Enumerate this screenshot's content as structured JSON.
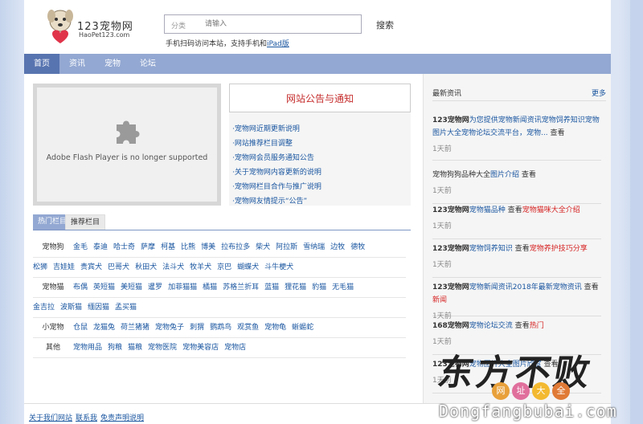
{
  "header": {
    "logo_name": "123宠物网",
    "logo_domain": "HaoPet123.com",
    "search_category": "分类",
    "search_placeholder": "请输入",
    "search_button": "搜索",
    "search_hint_text": "手机扫码访问本站，支持手机和",
    "search_hint_link": "iPad版"
  },
  "nav": {
    "items": [
      "首页",
      "资讯",
      "宠物",
      "论坛"
    ]
  },
  "flash": {
    "message": "Adobe Flash Player is no longer supported"
  },
  "notice": {
    "title": "网站公告与通知",
    "items": [
      "·宠物网近期更新说明",
      "·网站推荐栏目调整",
      "·宠物网会员服务通知公告",
      "·关于宠物网内容更新的说明",
      "·宠物网栏目合作与推广说明",
      "·宠物网友情提示“公告”"
    ]
  },
  "tabs": [
    "热门栏目",
    "推荐栏目"
  ],
  "link_rows": [
    {
      "label": "宠物狗",
      "links": [
        "金毛",
        "泰迪",
        "哈士奇",
        "萨摩",
        "柯基",
        "比熊",
        "博美",
        "拉布拉多",
        "柴犬",
        "阿拉斯",
        "雪纳瑞",
        "边牧",
        "德牧"
      ]
    },
    {
      "label": "",
      "links": [
        "松狮",
        "吉娃娃",
        "贵宾犬",
        "巴哥犬",
        "秋田犬",
        "法斗犬",
        "牧羊犬",
        "京巴",
        "蝴蝶犬",
        "斗牛梗犬"
      ]
    },
    {
      "label": "宠物猫",
      "links": [
        "布偶",
        "英短猫",
        "美短猫",
        "暹罗",
        "加菲猫猫",
        "橘猫",
        "苏格兰折耳",
        "蓝猫",
        "狸花猫",
        "豹猫",
        "无毛猫"
      ]
    },
    {
      "label": "",
      "links": [
        "金吉拉",
        "波斯猫",
        "缅因猫",
        "孟买猫"
      ]
    },
    {
      "label": "小宠物",
      "links": [
        "仓鼠",
        "龙猫兔",
        "荷兰猪猪",
        "宠物兔子",
        "刺猬",
        "鹦鹉鸟",
        "观赏鱼",
        "宠物龟",
        "蜥蜴蛇"
      ]
    },
    {
      "label": "其他",
      "links": [
        "宠物用品",
        "狗粮",
        "猫粮",
        "宠物医院",
        "宠物美容店",
        "宠物店"
      ]
    }
  ],
  "sidebar": {
    "title": "最新资讯",
    "more": "更多",
    "news": [
      {
        "bold": "123宠物网",
        "link": "为您提供宠物新闻资讯宠物饲养知识宠物图片大全宠物论坛交流平台，宠物...",
        "suffix": " 查看",
        "red": "",
        "time": "1天前"
      },
      {
        "bold": "",
        "pre": "宠物狗狗品种大全",
        "link": "图片介绍",
        "suffix": " 查看",
        "red": "",
        "time": "1天前"
      },
      {
        "bold": "123宠物网",
        "link": "宠物猫品种",
        "suffix": " 查看",
        "red": "宠物猫咪大全介绍",
        "time": "1天前"
      },
      {
        "bold": "123宠物网",
        "link": "宠物饲养知识",
        "suffix": " 查看",
        "red": "宠物养护技巧分享",
        "time": "1天前"
      },
      {
        "bold": "123宠物网",
        "link": "宠物新闻资讯2018年最新宠物资讯",
        "suffix": " 查看",
        "red": "新闻",
        "time": "1天前"
      },
      {
        "bold": "168宠物网",
        "link": "宠物论坛交流",
        "suffix": " 查看",
        "red": "热门",
        "time": "1天前"
      },
      {
        "bold": "123宠物网",
        "link": "宠物图片大全图片欣赏",
        "suffix": " 查看",
        "red": "",
        "time": "1天前"
      }
    ]
  },
  "footer": {
    "links": [
      "关于我们网站",
      "联系我",
      "免责声明说明"
    ]
  },
  "watermark": {
    "big": "东方不败",
    "sub": [
      "网",
      "址",
      "大",
      "全"
    ],
    "sub_colors": [
      "#e8a03a",
      "#e06f9c",
      "#f3b930",
      "#e07a36"
    ],
    "url": "Dongfangbubai.com"
  },
  "colors": {
    "nav_bg": "#93a8d2",
    "nav_active": "#5874b0",
    "link": "#1a56a0",
    "accent_red": "#c62d2d"
  }
}
